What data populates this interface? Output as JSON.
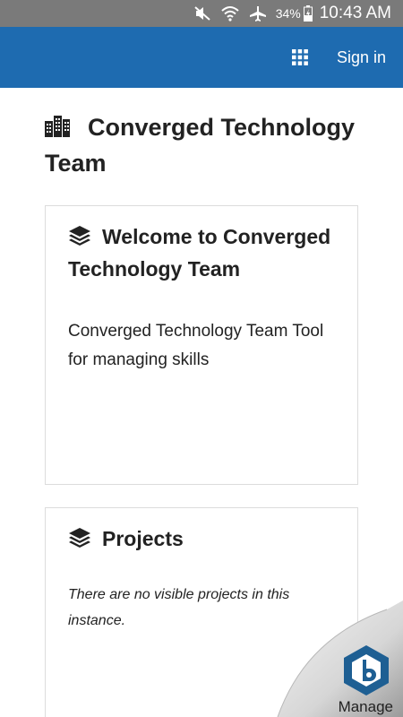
{
  "status_bar": {
    "battery_pct": "34%",
    "time": "10:43 AM",
    "icons": [
      "mute-icon",
      "wifi-icon",
      "airplane-icon",
      "battery-charging-icon"
    ]
  },
  "app_bar": {
    "color": "#1e6bb0",
    "apps_icon": "grid-icon",
    "sign_in_label": "Sign in"
  },
  "page": {
    "title": "Converged Technology Team",
    "title_icon": "building-icon"
  },
  "cards": [
    {
      "icon": "layers-icon",
      "title": "Welcome to Converged Technology Team",
      "body": "Converged Technology Team Tool for managing skills"
    },
    {
      "icon": "layers-icon",
      "title": "Projects",
      "empty_text": "There are no visible projects in this instance."
    }
  ],
  "manage": {
    "label": "Manage",
    "icon": "b-logo-icon"
  }
}
